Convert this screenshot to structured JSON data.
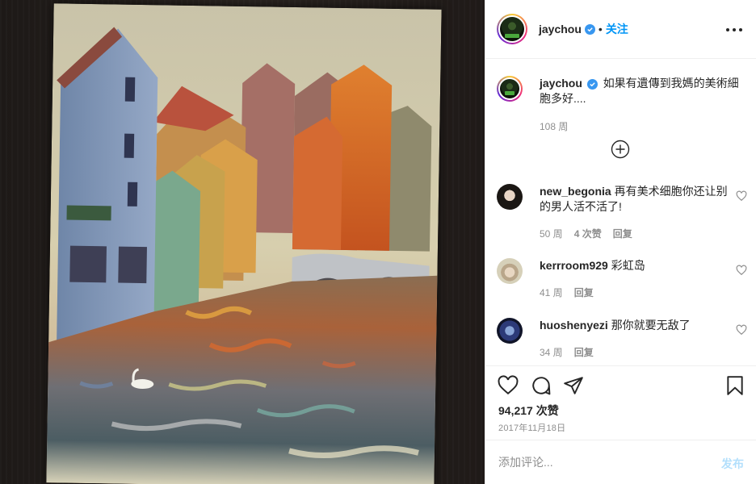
{
  "post": {
    "username": "jaychou",
    "follow_label": "关注",
    "dot": "•",
    "caption": "如果有遺傳到我媽的美術細胞多好....",
    "caption_age": "108 周"
  },
  "comments": [
    {
      "username": "new_begonia",
      "text": "再有美术细胞你还让别的男人活不活了!",
      "age": "50 周",
      "likes": "4 次赞",
      "reply_label": "回复"
    },
    {
      "username": "kerrroom929",
      "text": "彩虹岛",
      "age": "41 周",
      "reply_label": "回复"
    },
    {
      "username": "huoshenyezi",
      "text": "那你就要无敌了",
      "age": "34 周",
      "reply_label": "回复"
    }
  ],
  "stats": {
    "likes": "94,217 次赞",
    "date": "2017年11月18日"
  },
  "add_comment": {
    "placeholder": "添加评论...",
    "post_label": "发布"
  },
  "icons": {
    "verified": "verified-badge-icon",
    "more": "more-options-icon",
    "load_more": "plus-circle-icon",
    "like": "heart-icon",
    "comment": "comment-icon",
    "share": "share-icon",
    "save": "bookmark-icon"
  },
  "colors": {
    "accent": "#0095f6",
    "verified": "#3897f0",
    "post_disabled": "#b2dffc",
    "muted": "#8e8e8e"
  }
}
